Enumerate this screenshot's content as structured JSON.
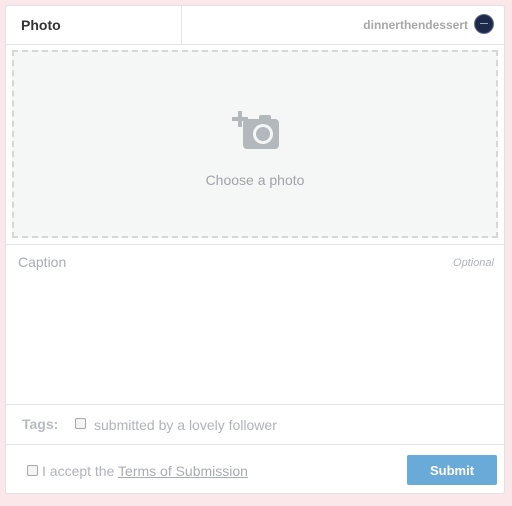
{
  "header": {
    "tab_label": "Photo",
    "blog_name": "dinnerthendessert"
  },
  "upload": {
    "label": "Choose a photo",
    "icon": "camera-add-icon"
  },
  "caption": {
    "placeholder": "Caption",
    "optional_label": "Optional"
  },
  "tags": {
    "label": "Tags:",
    "checkbox_label": "submitted by a lovely follower"
  },
  "footer": {
    "accept_prefix": "I accept the",
    "terms_link": "Terms of Submission",
    "submit_label": "Submit"
  },
  "colors": {
    "background": "#fbe6ea",
    "accent": "#62a6d6"
  }
}
